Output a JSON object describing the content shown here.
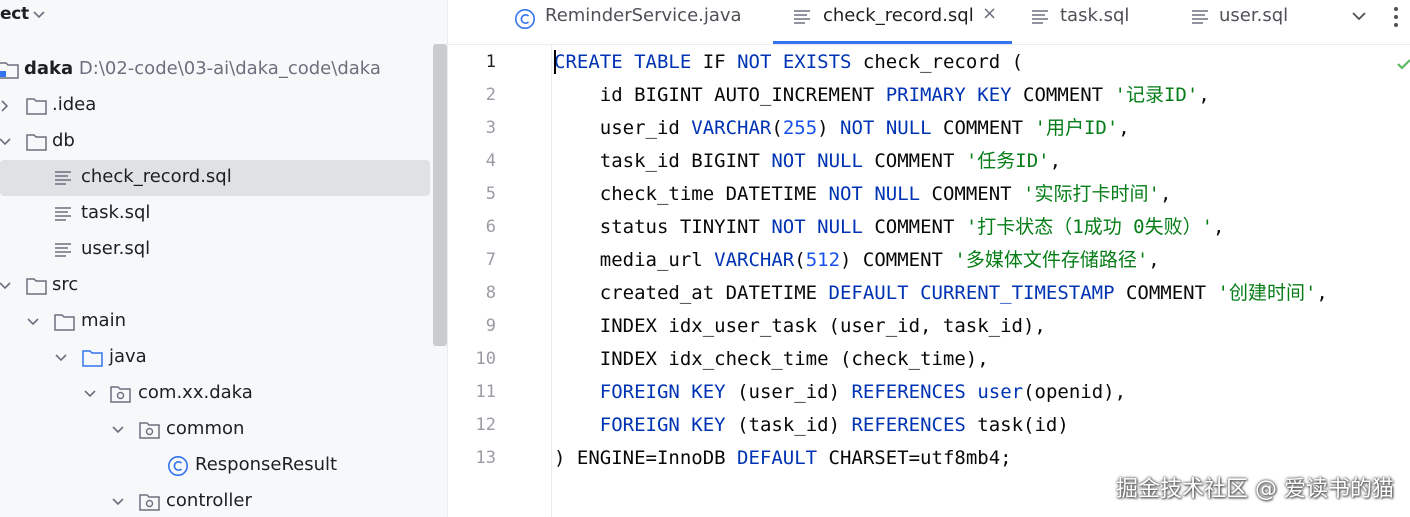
{
  "project": {
    "title": "ect",
    "tree": [
      {
        "label": "daka",
        "path": "D:\\02-code\\03-ai\\daka_code\\daka"
      },
      {
        "label": ".idea"
      },
      {
        "label": "db"
      },
      {
        "label": "check_record.sql"
      },
      {
        "label": "task.sql"
      },
      {
        "label": "user.sql"
      },
      {
        "label": "src"
      },
      {
        "label": "main"
      },
      {
        "label": "java"
      },
      {
        "label": "com.xx.daka"
      },
      {
        "label": "common"
      },
      {
        "label": "ResponseResult"
      },
      {
        "label": "controller"
      }
    ]
  },
  "tabs": [
    {
      "label": "ReminderService.java"
    },
    {
      "label": "check_record.sql",
      "close": "×"
    },
    {
      "label": "task.sql"
    },
    {
      "label": "user.sql"
    }
  ],
  "editor": {
    "line_numbers": [
      "1",
      "2",
      "3",
      "4",
      "5",
      "6",
      "7",
      "8",
      "9",
      "10",
      "11",
      "12",
      "13"
    ],
    "lines": [
      [
        {
          "t": "kw",
          "v": "CREATE"
        },
        {
          "t": "",
          "v": " "
        },
        {
          "t": "kw",
          "v": "TABLE"
        },
        {
          "t": "",
          "v": " IF "
        },
        {
          "t": "kw",
          "v": "NOT"
        },
        {
          "t": "",
          "v": " "
        },
        {
          "t": "kw",
          "v": "EXISTS"
        },
        {
          "t": "",
          "v": " check_record ("
        }
      ],
      [
        {
          "t": "",
          "v": "    id BIGINT AUTO_INCREMENT "
        },
        {
          "t": "kw",
          "v": "PRIMARY"
        },
        {
          "t": "",
          "v": " "
        },
        {
          "t": "kw",
          "v": "KEY"
        },
        {
          "t": "",
          "v": " COMMENT "
        },
        {
          "t": "str",
          "v": "'记录ID'"
        },
        {
          "t": "",
          "v": ","
        }
      ],
      [
        {
          "t": "",
          "v": "    user_id "
        },
        {
          "t": "kw",
          "v": "VARCHAR"
        },
        {
          "t": "",
          "v": "("
        },
        {
          "t": "num",
          "v": "255"
        },
        {
          "t": "",
          "v": ") "
        },
        {
          "t": "kw",
          "v": "NOT"
        },
        {
          "t": "",
          "v": " "
        },
        {
          "t": "kw",
          "v": "NULL"
        },
        {
          "t": "",
          "v": " COMMENT "
        },
        {
          "t": "str",
          "v": "'用户ID'"
        },
        {
          "t": "",
          "v": ","
        }
      ],
      [
        {
          "t": "",
          "v": "    task_id BIGINT "
        },
        {
          "t": "kw",
          "v": "NOT"
        },
        {
          "t": "",
          "v": " "
        },
        {
          "t": "kw",
          "v": "NULL"
        },
        {
          "t": "",
          "v": " COMMENT "
        },
        {
          "t": "str",
          "v": "'任务ID'"
        },
        {
          "t": "",
          "v": ","
        }
      ],
      [
        {
          "t": "",
          "v": "    check_time DATETIME "
        },
        {
          "t": "kw",
          "v": "NOT"
        },
        {
          "t": "",
          "v": " "
        },
        {
          "t": "kw",
          "v": "NULL"
        },
        {
          "t": "",
          "v": " COMMENT "
        },
        {
          "t": "str",
          "v": "'实际打卡时间'"
        },
        {
          "t": "",
          "v": ","
        }
      ],
      [
        {
          "t": "",
          "v": "    status TINYINT "
        },
        {
          "t": "kw",
          "v": "NOT"
        },
        {
          "t": "",
          "v": " "
        },
        {
          "t": "kw",
          "v": "NULL"
        },
        {
          "t": "",
          "v": " COMMENT "
        },
        {
          "t": "str",
          "v": "'打卡状态（1成功 0失败）'"
        },
        {
          "t": "",
          "v": ","
        }
      ],
      [
        {
          "t": "",
          "v": "    media_url "
        },
        {
          "t": "kw",
          "v": "VARCHAR"
        },
        {
          "t": "",
          "v": "("
        },
        {
          "t": "num",
          "v": "512"
        },
        {
          "t": "",
          "v": ") COMMENT "
        },
        {
          "t": "str",
          "v": "'多媒体文件存储路径'"
        },
        {
          "t": "",
          "v": ","
        }
      ],
      [
        {
          "t": "",
          "v": "    created_at DATETIME "
        },
        {
          "t": "kw",
          "v": "DEFAULT"
        },
        {
          "t": "",
          "v": " "
        },
        {
          "t": "kw",
          "v": "CURRENT_TIMESTAMP"
        },
        {
          "t": "",
          "v": " COMMENT "
        },
        {
          "t": "str",
          "v": "'创建时间'"
        },
        {
          "t": "",
          "v": ","
        }
      ],
      [
        {
          "t": "",
          "v": "    INDEX idx_user_task (user_id, task_id),"
        }
      ],
      [
        {
          "t": "",
          "v": "    INDEX idx_check_time (check_time),"
        }
      ],
      [
        {
          "t": "",
          "v": "    "
        },
        {
          "t": "kw",
          "v": "FOREIGN"
        },
        {
          "t": "",
          "v": " "
        },
        {
          "t": "kw",
          "v": "KEY"
        },
        {
          "t": "",
          "v": " (user_id) "
        },
        {
          "t": "kw",
          "v": "REFERENCES"
        },
        {
          "t": "",
          "v": " "
        },
        {
          "t": "kw",
          "v": "user"
        },
        {
          "t": "",
          "v": "(openid),"
        }
      ],
      [
        {
          "t": "",
          "v": "    "
        },
        {
          "t": "kw",
          "v": "FOREIGN"
        },
        {
          "t": "",
          "v": " "
        },
        {
          "t": "kw",
          "v": "KEY"
        },
        {
          "t": "",
          "v": " (task_id) "
        },
        {
          "t": "kw",
          "v": "REFERENCES"
        },
        {
          "t": "",
          "v": " task(id)"
        }
      ],
      [
        {
          "t": "",
          "v": ") ENGINE=InnoDB "
        },
        {
          "t": "kw",
          "v": "DEFAULT"
        },
        {
          "t": "",
          "v": " CHARSET=utf8mb4;"
        }
      ]
    ]
  },
  "watermark": "掘金技术社区 @ 爱读书的猫",
  "colors": {
    "keyword": "#0033b3",
    "number": "#1750eb",
    "string": "#067d17",
    "accent": "#3574f0"
  }
}
